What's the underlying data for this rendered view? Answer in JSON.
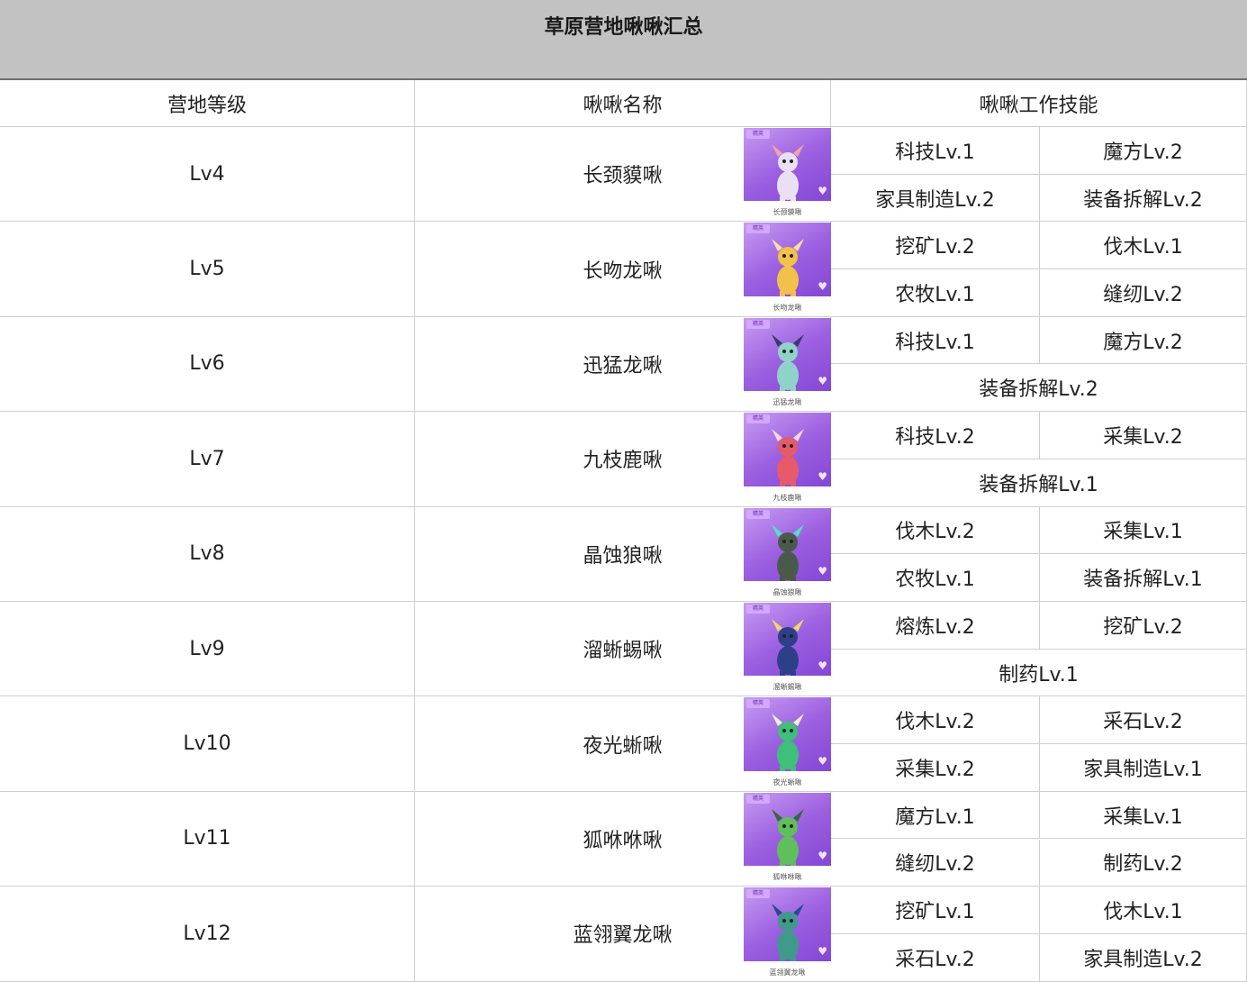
{
  "title": "草原营地啾啾汇总",
  "headers": {
    "level": "营地等级",
    "name": "啾啾名称",
    "skills": "啾啾工作技能"
  },
  "badge_label": "精英",
  "colors": {
    "title_bg": "#c2c2c2",
    "card_purple": "#9b5fe0",
    "grid_line": "#cfcfcf"
  },
  "rows": [
    {
      "level": "Lv4",
      "name": "长颈貘啾",
      "caption": "长颈貘啾",
      "body_color": "#e9e0f4",
      "accent_color": "#f0a4a8",
      "skills": [
        "科技Lv.1",
        "魔方Lv.2",
        "家具制造Lv.2",
        "装备拆解Lv.2"
      ]
    },
    {
      "level": "Lv5",
      "name": "长吻龙啾",
      "caption": "长吻龙啾",
      "body_color": "#f2c14a",
      "accent_color": "#f7e3a0",
      "skills": [
        "挖矿Lv.2",
        "伐木Lv.1",
        "农牧Lv.1",
        "缝纫Lv.2"
      ]
    },
    {
      "level": "Lv6",
      "name": "迅猛龙啾",
      "caption": "迅猛龙啾",
      "body_color": "#8fd3c8",
      "accent_color": "#3a3a6a",
      "skills": [
        "科技Lv.1",
        "魔方Lv.2",
        "装备拆解Lv.2"
      ]
    },
    {
      "level": "Lv7",
      "name": "九枝鹿啾",
      "caption": "九枝鹿啾",
      "body_color": "#e65a6a",
      "accent_color": "#f3d9dd",
      "skills": [
        "科技Lv.2",
        "采集Lv.2",
        "装备拆解Lv.1"
      ]
    },
    {
      "level": "Lv8",
      "name": "晶蚀狼啾",
      "caption": "晶蚀狼啾",
      "body_color": "#4a5a4a",
      "accent_color": "#52e0c8",
      "skills": [
        "伐木Lv.2",
        "采集Lv.1",
        "农牧Lv.1",
        "装备拆解Lv.1"
      ]
    },
    {
      "level": "Lv9",
      "name": "溜蜥蜴啾",
      "caption": "溜蜥蜴啾",
      "body_color": "#2e3f8a",
      "accent_color": "#f1d66a",
      "skills": [
        "熔炼Lv.2",
        "挖矿Lv.2",
        "制药Lv.1"
      ]
    },
    {
      "level": "Lv10",
      "name": "夜光蜥啾",
      "caption": "夜光蜥啾",
      "body_color": "#3fbf7a",
      "accent_color": "#e8f4c8",
      "skills": [
        "伐木Lv.2",
        "采石Lv.2",
        "采集Lv.2",
        "家具制造Lv.1"
      ]
    },
    {
      "level": "Lv11",
      "name": "狐咻咻啾",
      "caption": "狐咻咻啾",
      "body_color": "#5fbf5a",
      "accent_color": "#2e6b3a",
      "skills": [
        "魔方Lv.1",
        "采集Lv.1",
        "缝纫Lv.2",
        "制药Lv.2"
      ]
    },
    {
      "level": "Lv12",
      "name": "蓝翎翼龙啾",
      "caption": "蓝翎翼龙啾",
      "body_color": "#3f9a8a",
      "accent_color": "#2a4a8a",
      "skills": [
        "挖矿Lv.1",
        "伐木Lv.1",
        "采石Lv.2",
        "家具制造Lv.2"
      ]
    }
  ]
}
